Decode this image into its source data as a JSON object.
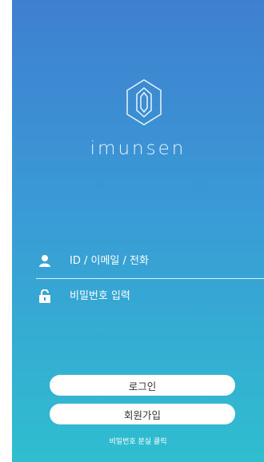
{
  "brand": {
    "name": "imunsen",
    "logo_icon": "hexagon-logo-icon"
  },
  "login_form": {
    "id_field": {
      "placeholder": "ID / 이메일 / 전화",
      "value": "",
      "icon": "user-icon"
    },
    "password_field": {
      "placeholder": "비밀번호 입력",
      "value": "",
      "icon": "lock-icon"
    }
  },
  "buttons": {
    "login_label": "로그인",
    "signup_label": "회원가입"
  },
  "links": {
    "forgot_password": "비밀번호 분실 클릭"
  },
  "colors": {
    "gradient_top": "#3f7fcf",
    "gradient_bottom": "#2fbecf",
    "button_bg": "#ffffff"
  }
}
